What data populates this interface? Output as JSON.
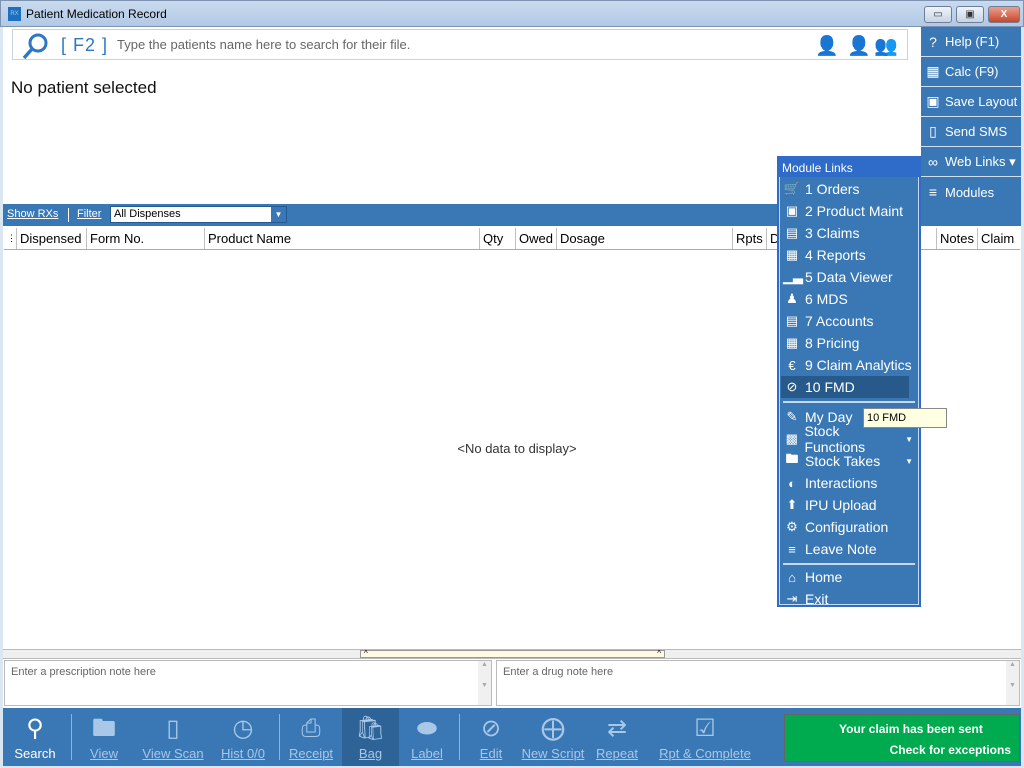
{
  "window": {
    "title": "Patient Medication Record",
    "minimize": "▭",
    "restore": "▣",
    "close": "X"
  },
  "search": {
    "hotkey": "[ F2 ]",
    "placeholder": "Type the patients name here to search for their file.",
    "icons": [
      "find-patient-icon",
      "add-patient-icon",
      "patient-group-icon"
    ]
  },
  "patient": {
    "status": "No patient selected"
  },
  "right_panel": [
    {
      "label": "Help (F1)",
      "icon": "help-icon"
    },
    {
      "label": "Calc (F9)",
      "icon": "calculator-icon"
    },
    {
      "label": "Save Layout",
      "icon": "save-icon"
    },
    {
      "label": "Send SMS",
      "icon": "phone-icon"
    },
    {
      "label": "Web Links ▾",
      "icon": "link-icon"
    },
    {
      "label": "Modules",
      "icon": "list-icon"
    }
  ],
  "strip": {
    "show_rxs": "Show RXs",
    "filter_label": "Filter",
    "filter_value": "All Dispenses"
  },
  "grid": {
    "columns": [
      "Dispensed",
      "Form No.",
      "Product Name",
      "Qty",
      "Owed",
      "Dosage",
      "Rpts",
      "D",
      "Notes",
      "Claim"
    ],
    "empty_text": "<No data to display>"
  },
  "notes": {
    "prescription_placeholder": "Enter a prescription note here",
    "drug_placeholder": "Enter a drug note here"
  },
  "bottom_toolbar": [
    {
      "label": "Search",
      "icon": "search-icon",
      "enabled": true
    },
    {
      "label": "View",
      "icon": "view-folder-icon",
      "enabled": false
    },
    {
      "label": "View Scan",
      "icon": "scan-icon",
      "enabled": false
    },
    {
      "label": "Hist 0/0",
      "icon": "history-icon",
      "enabled": false
    },
    {
      "label": "Receipt",
      "icon": "printer-icon",
      "enabled": false
    },
    {
      "label": "Bag",
      "icon": "bag-icon",
      "enabled": false
    },
    {
      "label": "Label",
      "icon": "pill-icon",
      "enabled": false
    },
    {
      "label": "Edit",
      "icon": "edit-icon",
      "enabled": false
    },
    {
      "label": "New Script",
      "icon": "new-script-icon",
      "enabled": false
    },
    {
      "label": "Repeat",
      "icon": "repeat-icon",
      "enabled": false
    },
    {
      "label": "Rpt & Complete",
      "icon": "repeat-complete-icon",
      "enabled": false
    }
  ],
  "claim_status": {
    "line1": "Your claim has been sent",
    "line2": "Check for exceptions",
    "color": "#00aa4f"
  },
  "module_links": {
    "title": "Module Links",
    "groups": [
      [
        {
          "label": "1 Orders",
          "icon": "cart-icon"
        },
        {
          "label": "2 Product Maint",
          "icon": "box-icon"
        },
        {
          "label": "3 Claims",
          "icon": "scroll-icon"
        },
        {
          "label": "4 Reports",
          "icon": "report-icon"
        },
        {
          "label": "5 Data Viewer",
          "icon": "bar-chart-icon"
        },
        {
          "label": "6 MDS",
          "icon": "person-icon"
        },
        {
          "label": "7 Accounts",
          "icon": "clipboard-icon"
        },
        {
          "label": "8 Pricing",
          "icon": "calculator-icon"
        },
        {
          "label": "9 Claim Analytics",
          "icon": "euro-icon"
        },
        {
          "label": "10 FMD",
          "icon": "fmd-icon",
          "selected": true
        }
      ],
      [
        {
          "label": "My Day",
          "icon": "notepad-icon"
        },
        {
          "label": "Stock Functions",
          "icon": "stock-icon",
          "submenu": true
        },
        {
          "label": "Stock Takes",
          "icon": "folder-upload-icon",
          "submenu": true
        },
        {
          "label": "Interactions",
          "icon": "interactions-icon"
        },
        {
          "label": "IPU Upload",
          "icon": "upload-icon"
        },
        {
          "label": "Configuration",
          "icon": "gear-icon"
        },
        {
          "label": "Leave Note",
          "icon": "layers-icon"
        }
      ],
      [
        {
          "label": "Home",
          "icon": "home-icon"
        },
        {
          "label": "Exit",
          "icon": "exit-icon"
        }
      ]
    ]
  },
  "tooltip": "10 FMD",
  "colors": {
    "accent": "#3a78b5",
    "menu_header": "#2f6bc9",
    "selected": "#27598a"
  }
}
